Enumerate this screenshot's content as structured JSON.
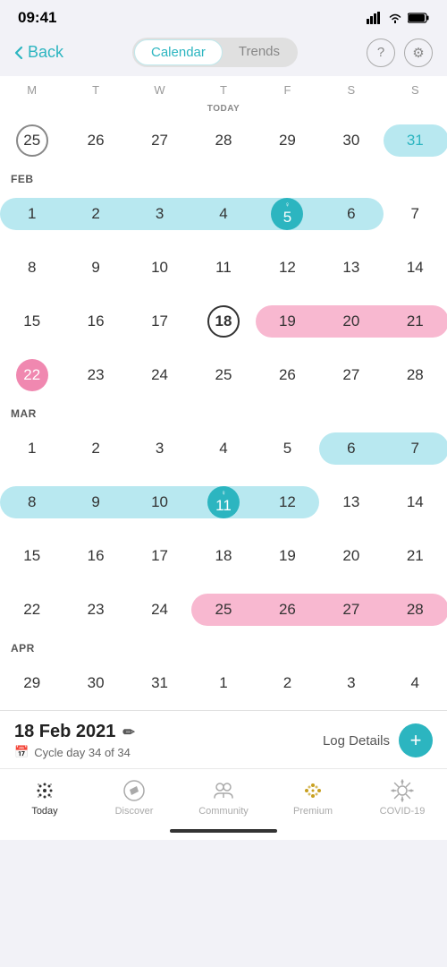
{
  "statusBar": {
    "time": "09:41",
    "signal": "●●●●",
    "wifi": "wifi",
    "battery": "battery"
  },
  "header": {
    "backLabel": "Back",
    "tabs": [
      {
        "id": "calendar",
        "label": "Calendar",
        "active": true
      },
      {
        "id": "trends",
        "label": "Trends",
        "active": false
      }
    ],
    "helpIcon": "?",
    "settingsIcon": "⚙"
  },
  "dayHeaders": [
    "M",
    "T",
    "W",
    "T",
    "F",
    "S",
    "S"
  ],
  "calendar": {
    "weeks": [
      {
        "monthLabel": "TODAY",
        "days": [
          {
            "num": "25",
            "today": true,
            "col": 1
          },
          {
            "num": "26",
            "col": 2
          },
          {
            "num": "27",
            "col": 3
          },
          {
            "num": "28",
            "col": 4
          },
          {
            "num": "29",
            "col": 5
          },
          {
            "num": "30",
            "col": 6
          },
          {
            "num": "31",
            "col": 7,
            "blueHighlight": true
          }
        ]
      },
      {
        "monthLabel": "FEB",
        "days": [
          {
            "num": "1",
            "col": 1,
            "blueHighlight": true
          },
          {
            "num": "2",
            "col": 2,
            "blueHighlight": true
          },
          {
            "num": "3",
            "col": 3,
            "blueHighlight": true
          },
          {
            "num": "4",
            "col": 4,
            "blueHighlight": true
          },
          {
            "num": "5",
            "col": 5,
            "ovulation": true
          },
          {
            "num": "6",
            "col": 6,
            "blueHighlight": true
          },
          {
            "num": "7",
            "col": 7
          }
        ]
      },
      {
        "days": [
          {
            "num": "8",
            "col": 1
          },
          {
            "num": "9",
            "col": 2
          },
          {
            "num": "10",
            "col": 3
          },
          {
            "num": "11",
            "col": 4
          },
          {
            "num": "12",
            "col": 5
          },
          {
            "num": "13",
            "col": 6
          },
          {
            "num": "14",
            "col": 7
          }
        ]
      },
      {
        "days": [
          {
            "num": "15",
            "col": 1
          },
          {
            "num": "16",
            "col": 2
          },
          {
            "num": "17",
            "col": 3
          },
          {
            "num": "18",
            "col": 4,
            "selected": true
          },
          {
            "num": "19",
            "col": 5,
            "pinkHighlight": true
          },
          {
            "num": "20",
            "col": 6,
            "pinkHighlight": true
          },
          {
            "num": "21",
            "col": 7,
            "pinkHighlight": true
          }
        ]
      },
      {
        "days": [
          {
            "num": "22",
            "col": 1,
            "periodStart": true
          },
          {
            "num": "23",
            "col": 2
          },
          {
            "num": "24",
            "col": 3
          },
          {
            "num": "25",
            "col": 4
          },
          {
            "num": "26",
            "col": 5
          },
          {
            "num": "27",
            "col": 6
          },
          {
            "num": "28",
            "col": 7
          }
        ]
      },
      {
        "monthLabel": "MAR",
        "days": [
          {
            "num": "1",
            "col": 1
          },
          {
            "num": "2",
            "col": 2
          },
          {
            "num": "3",
            "col": 3
          },
          {
            "num": "4",
            "col": 4
          },
          {
            "num": "5",
            "col": 5
          },
          {
            "num": "6",
            "col": 6,
            "blueHighlight": true
          },
          {
            "num": "7",
            "col": 7,
            "blueHighlight": true
          }
        ]
      },
      {
        "days": [
          {
            "num": "8",
            "col": 1,
            "blueHighlight": true
          },
          {
            "num": "9",
            "col": 2,
            "blueHighlight": true
          },
          {
            "num": "10",
            "col": 3,
            "blueHighlight": true
          },
          {
            "num": "11",
            "col": 4,
            "ovulation": true
          },
          {
            "num": "12",
            "col": 5,
            "blueHighlight": true
          },
          {
            "num": "13",
            "col": 6
          },
          {
            "num": "14",
            "col": 7
          }
        ]
      },
      {
        "days": [
          {
            "num": "15",
            "col": 1
          },
          {
            "num": "16",
            "col": 2
          },
          {
            "num": "17",
            "col": 3
          },
          {
            "num": "18",
            "col": 4
          },
          {
            "num": "19",
            "col": 5
          },
          {
            "num": "20",
            "col": 6
          },
          {
            "num": "21",
            "col": 7
          }
        ]
      },
      {
        "days": [
          {
            "num": "22",
            "col": 1
          },
          {
            "num": "23",
            "col": 2
          },
          {
            "num": "24",
            "col": 3
          },
          {
            "num": "25",
            "col": 4,
            "pinkHighlight": true
          },
          {
            "num": "26",
            "col": 5,
            "pinkHighlight": true
          },
          {
            "num": "27",
            "col": 6,
            "pinkHighlight": true
          },
          {
            "num": "28",
            "col": 7,
            "pinkHighlight": true
          }
        ]
      },
      {
        "monthLabel": "APR",
        "days": [
          {
            "num": "29",
            "col": 1
          },
          {
            "num": "30",
            "col": 2
          },
          {
            "num": "31",
            "col": 3
          },
          {
            "num": "1",
            "col": 4
          },
          {
            "num": "2",
            "col": 5
          },
          {
            "num": "3",
            "col": 6
          },
          {
            "num": "4",
            "col": 7
          }
        ]
      }
    ]
  },
  "bottomInfo": {
    "date": "18 Feb 2021",
    "cycleDay": "Cycle day 34 of 34",
    "logDetailsLabel": "Log Details"
  },
  "nav": {
    "items": [
      {
        "id": "today",
        "label": "Today",
        "active": true
      },
      {
        "id": "discover",
        "label": "Discover",
        "active": false
      },
      {
        "id": "community",
        "label": "Community",
        "active": false
      },
      {
        "id": "premium",
        "label": "Premium",
        "active": false
      },
      {
        "id": "covid19",
        "label": "COVID-19",
        "active": false
      }
    ]
  },
  "colors": {
    "teal": "#2cb5c0",
    "blue_light": "#b8e8f0",
    "pink_light": "#f8b8d0",
    "pink_period": "#f088b0"
  }
}
